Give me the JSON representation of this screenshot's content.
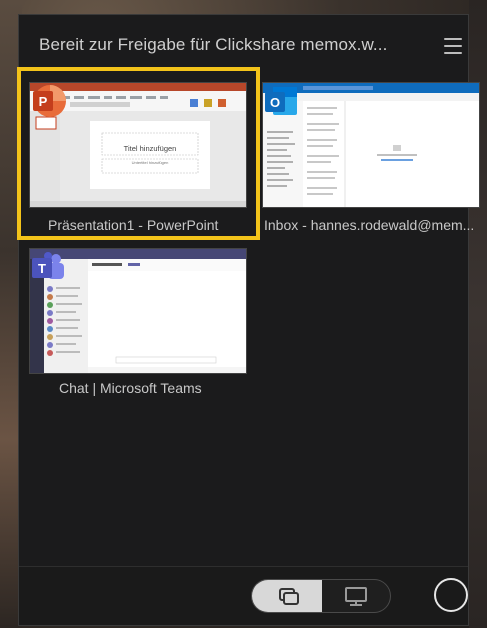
{
  "header": {
    "title": "Bereit zur Freigabe für Clickshare memox.w...",
    "menu_icon": "hamburger-menu-icon"
  },
  "windows": [
    {
      "label": "Präsentation1 - PowerPoint",
      "app": "powerpoint",
      "app_icon_letter": "P",
      "slide_title": "Titel hinzufügen",
      "slide_subtitle": "Untertitel hinzufügen",
      "selected": true
    },
    {
      "label": "Inbox - hannes.rodewald@mem...",
      "app": "outlook",
      "app_icon_letter": "O",
      "selected": false
    },
    {
      "label": "Chat | Microsoft Teams",
      "app": "teams",
      "app_icon_letter": "T",
      "selected": false
    }
  ],
  "bottom": {
    "toggle_left_icon": "window-share-icon",
    "toggle_right_icon": "desktop-share-icon",
    "record_icon": "circle-button-icon"
  },
  "colors": {
    "accent_selection": "#f3c31a",
    "powerpoint": "#c43e1c",
    "outlook": "#0f6cbd",
    "teams": "#5b5fc7",
    "panel_bg": "#1b1b1c"
  }
}
